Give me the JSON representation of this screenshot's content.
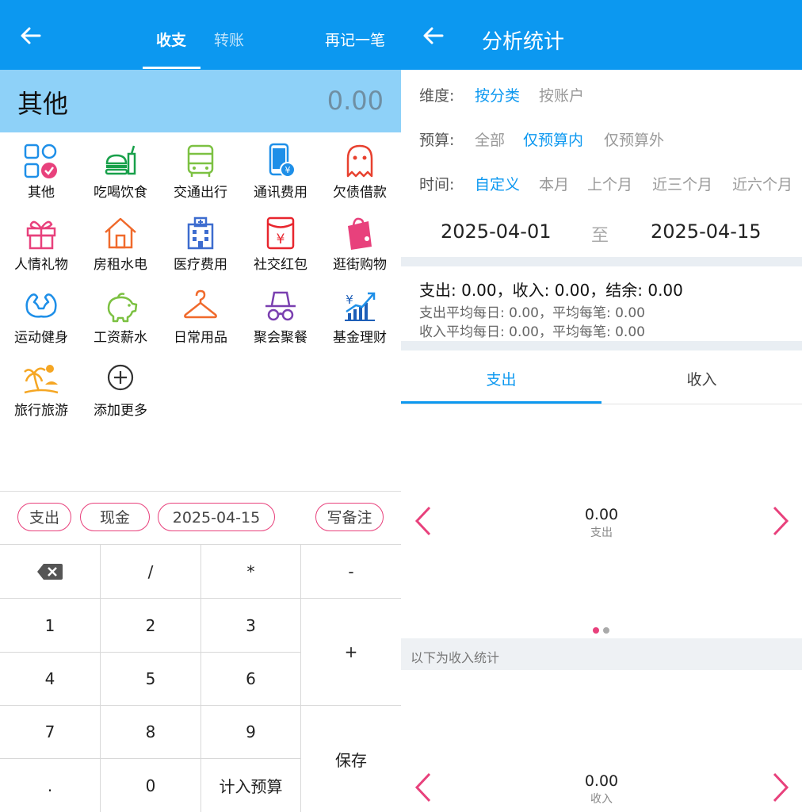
{
  "left": {
    "header": {
      "tab_income_expense": "收支",
      "tab_transfer": "转账",
      "record_again": "再记一笔"
    },
    "amount_bar": {
      "category": "其他",
      "amount": "0.00"
    },
    "categories": [
      {
        "label": "其他",
        "icon": "grid-check-icon"
      },
      {
        "label": "吃喝饮食",
        "icon": "food-drink-icon"
      },
      {
        "label": "交通出行",
        "icon": "bus-icon"
      },
      {
        "label": "通讯费用",
        "icon": "phone-yuan-icon"
      },
      {
        "label": "欠债借款",
        "icon": "ghost-icon"
      },
      {
        "label": "人情礼物",
        "icon": "gift-icon"
      },
      {
        "label": "房租水电",
        "icon": "house-icon"
      },
      {
        "label": "医疗费用",
        "icon": "hospital-icon"
      },
      {
        "label": "社交红包",
        "icon": "red-packet-icon"
      },
      {
        "label": "逛街购物",
        "icon": "shopping-bag-icon"
      },
      {
        "label": "运动健身",
        "icon": "muscle-icon"
      },
      {
        "label": "工资薪水",
        "icon": "piggy-bank-icon"
      },
      {
        "label": "日常用品",
        "icon": "hanger-icon"
      },
      {
        "label": "聚会聚餐",
        "icon": "incognito-icon"
      },
      {
        "label": "基金理财",
        "icon": "stock-chart-icon"
      },
      {
        "label": "旅行旅游",
        "icon": "beach-icon"
      },
      {
        "label": "添加更多",
        "icon": "plus-circle-icon"
      }
    ],
    "chips": {
      "type": "支出",
      "account": "现金",
      "date": "2025-04-15",
      "note": "写备注"
    },
    "keypad": {
      "r0": [
        "",
        "/",
        "*",
        "-"
      ],
      "r1": [
        "1",
        "2",
        "3"
      ],
      "r2": [
        "4",
        "5",
        "6"
      ],
      "r3": [
        "7",
        "8",
        "9"
      ],
      "r4": [
        ".",
        "0",
        "计入预算"
      ],
      "plus": "+",
      "save": "保存"
    }
  },
  "right": {
    "header": {
      "title": "分析统计"
    },
    "dimension": {
      "label": "维度:",
      "options": [
        "按分类",
        "按账户"
      ]
    },
    "budget": {
      "label": "预算:",
      "options": [
        "全部",
        "仅预算内",
        "仅预算外"
      ]
    },
    "time": {
      "label": "时间:",
      "options": [
        "自定义",
        "本月",
        "上个月",
        "近三个月",
        "近六个月"
      ]
    },
    "range": {
      "start": "2025-04-01",
      "to": "至",
      "end": "2025-04-15"
    },
    "summary": {
      "main": "支出: 0.00，收入: 0.00，结余: 0.00",
      "expense_avg": "支出平均每日: 0.00，平均每笔: 0.00",
      "income_avg": "收入平均每日: 0.00，平均每笔: 0.00"
    },
    "tabs": [
      "支出",
      "收入"
    ],
    "expense_card": {
      "value": "0.00",
      "label": "支出"
    },
    "income_section": "以下为收入统计",
    "income_card": {
      "value": "0.00",
      "label": "收入"
    },
    "colors": {
      "primary": "#0c98f0",
      "accent": "#e8417c"
    }
  }
}
